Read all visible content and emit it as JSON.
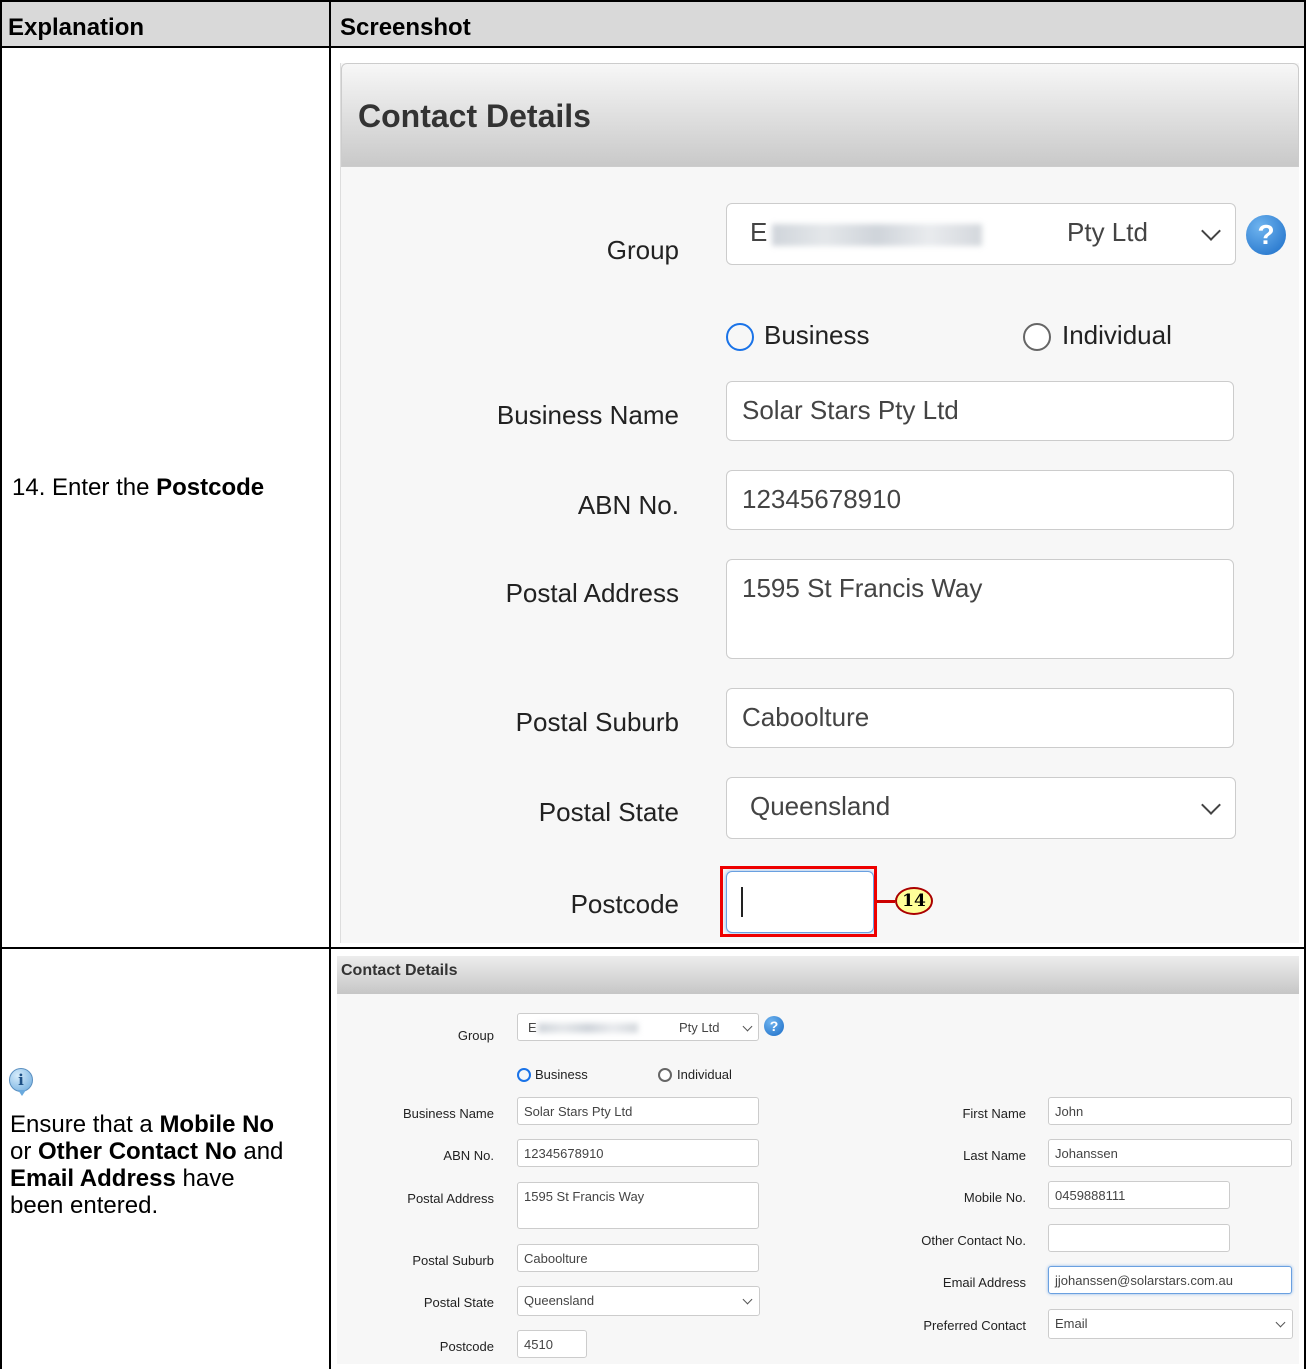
{
  "table": {
    "col_explanation": "Explanation",
    "col_screenshot": "Screenshot"
  },
  "row1": {
    "step_prefix": "14. Enter the ",
    "step_bold": "Postcode"
  },
  "row2": {
    "icon": "info-icon",
    "p1": "Ensure that a ",
    "b1": "Mobile No",
    "p2": "or ",
    "b2": "Other Contact No",
    "p3": " and",
    "b3": "Email Address",
    "p4": " have",
    "p5": "been entered."
  },
  "big_form": {
    "title": "Contact Details",
    "group_label": "Group",
    "group_value_start": "E",
    "group_value_end": "Pty Ltd",
    "help_icon": "?",
    "radio_business": "Business",
    "radio_individual": "Individual",
    "business_name_label": "Business Name",
    "business_name_value": "Solar Stars Pty Ltd",
    "abn_label": "ABN No.",
    "abn_value": "12345678910",
    "postal_address_label": "Postal Address",
    "postal_address_value": "1595 St Francis Way",
    "postal_suburb_label": "Postal Suburb",
    "postal_suburb_value": "Caboolture",
    "postal_state_label": "Postal State",
    "postal_state_value": "Queensland",
    "postcode_label": "Postcode",
    "postcode_value": "",
    "callout_number": "14",
    "highlight_color": "#e00000",
    "radio_color": "#1a73e8"
  },
  "small_form": {
    "title": "Contact Details",
    "group_label": "Group",
    "group_value_start": "E",
    "group_value_end": "Pty Ltd",
    "radio_business": "Business",
    "radio_individual": "Individual",
    "business_name_label": "Business Name",
    "business_name_value": "Solar Stars Pty Ltd",
    "abn_label": "ABN No.",
    "abn_value": "12345678910",
    "postal_address_label": "Postal Address",
    "postal_address_value": "1595 St Francis Way",
    "postal_suburb_label": "Postal Suburb",
    "postal_suburb_value": "Caboolture",
    "postal_state_label": "Postal State",
    "postal_state_value": "Queensland",
    "postcode_label": "Postcode",
    "postcode_value": "4510",
    "first_name_label": "First Name",
    "first_name_value": "John",
    "last_name_label": "Last Name",
    "last_name_value": "Johanssen",
    "mobile_label": "Mobile No.",
    "mobile_value": "0459888111",
    "other_contact_label": "Other Contact No.",
    "other_contact_value": "",
    "email_label": "Email Address",
    "email_value": "jjohanssen@solarstars.com.au",
    "preferred_label": "Preferred Contact",
    "preferred_value": "Email"
  }
}
